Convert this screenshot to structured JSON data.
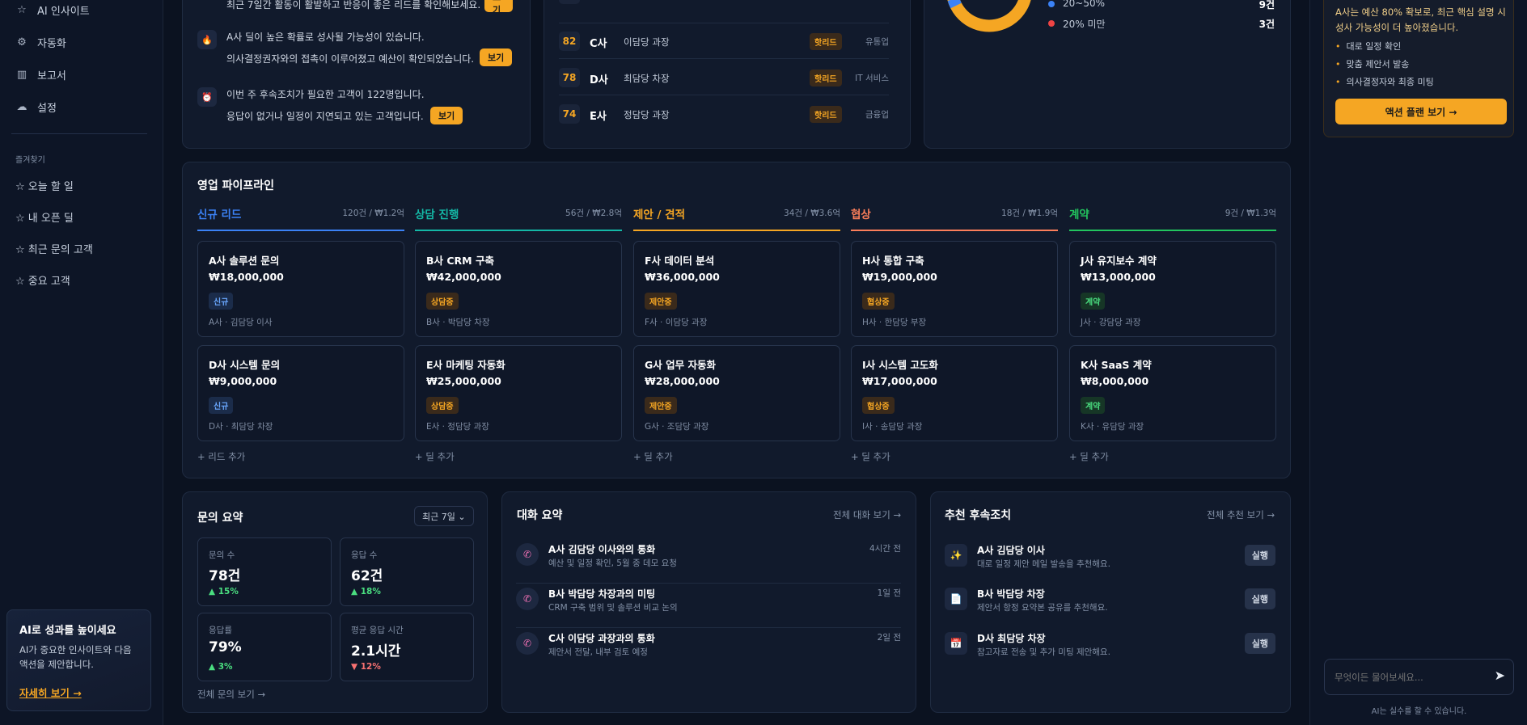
{
  "sidebar": {
    "nav": [
      {
        "label": "AI 인사이트",
        "icon": "star-icon"
      },
      {
        "label": "자동화",
        "icon": "gear-icon"
      },
      {
        "label": "보고서",
        "icon": "bar-chart-icon"
      },
      {
        "label": "설정",
        "icon": "cloud-settings-icon"
      }
    ],
    "favorites_title": "즐겨찾기",
    "favorites": [
      "☆ 오늘 할 일",
      "☆ 내 오픈 딜",
      "☆ 최근 문의 고객",
      "☆ 중요 고객"
    ],
    "promo": {
      "title": "AI로 성과를 높이세요",
      "desc1": "AI가 중요한 인사이트와 다음",
      "desc2": "액션을 제안합니다.",
      "link": "자세히 보기 →"
    }
  },
  "insights": {
    "row0_text": "최근 7일간 활동이 활발하고 반응이 좋은 리드를 확인해보세요.",
    "row0_btn": "보기",
    "row1_line1": "A사 딜이 높은 확률로 성사될 가능성이 있습니다.",
    "row1_line2": "의사결정권자와의 접촉이 이루어졌고 예산이 확인되었습니다.",
    "row1_btn": "보기",
    "row2_line1": "이번 주 후속조치가 필요한 고객이 122명입니다.",
    "row2_line2": "응답이 없거나 일정이 지연되고 있는 고객입니다.",
    "row2_btn": "보기"
  },
  "leads": [
    {
      "score": "82",
      "company": "C사",
      "person": "이담당 과장",
      "badge": "핫리드",
      "industry": "유통업"
    },
    {
      "score": "78",
      "company": "D사",
      "person": "최담당 차장",
      "badge": "핫리드",
      "industry": "IT 서비스"
    },
    {
      "score": "74",
      "company": "E사",
      "person": "정담당 과장",
      "badge": "핫리드",
      "industry": "금융업"
    }
  ],
  "deal_stats": [
    {
      "label": "20~50%",
      "value": "9건",
      "color": "#3b82f6"
    },
    {
      "label": "20% 미만",
      "value": "3건",
      "color": "#ef4444"
    }
  ],
  "donut_colors": {
    "main": "#f5a623",
    "accent": "#3b82f6"
  },
  "ai_panel": {
    "summary1": "A사는 예산 80% 확보로, 최근 핵심 설명 시",
    "summary2": "성사 가능성이 더 높아졌습니다.",
    "bullets": [
      "대로 일정 확인",
      "맞춤 제안서 발송",
      "의사결정자와 최종 미팅"
    ],
    "action_btn": "액션 플랜 보기 →",
    "input_placeholder": "무엇이든 물어보세요...",
    "disclaimer": "AI는 실수를 할 수 있습니다."
  },
  "pipeline": {
    "title": "영업 파이프라인",
    "columns": [
      {
        "name": "신규 리드",
        "meta": "120건 / ₩1.2억",
        "color": "#3b82f6",
        "add": "+ 리드 추가",
        "deals": [
          {
            "name": "A사 솔루션 문의",
            "value": "₩18,000,000",
            "badge": "신규",
            "person": "A사 · 김담당 이사"
          },
          {
            "name": "D사 시스템 문의",
            "value": "₩9,000,000",
            "badge": "신규",
            "person": "D사 · 최담당 차장"
          }
        ]
      },
      {
        "name": "상담 진행",
        "meta": "56건 / ₩2.8억",
        "color": "#14b8a6",
        "add": "+ 딜 추가",
        "deals": [
          {
            "name": "B사 CRM 구축",
            "value": "₩42,000,000",
            "badge": "상담중",
            "person": "B사 · 박담당 차장"
          },
          {
            "name": "E사 마케팅 자동화",
            "value": "₩25,000,000",
            "badge": "상담중",
            "person": "E사 · 정담당 과장"
          }
        ]
      },
      {
        "name": "제안 / 견적",
        "meta": "34건 / ₩3.6억",
        "color": "#f5a623",
        "add": "+ 딜 추가",
        "deals": [
          {
            "name": "F사 데이터 분석",
            "value": "₩36,000,000",
            "badge": "제안중",
            "person": "F사 · 이담당 과장"
          },
          {
            "name": "G사 업무 자동화",
            "value": "₩28,000,000",
            "badge": "제안중",
            "person": "G사 · 조담당 과장"
          }
        ]
      },
      {
        "name": "협상",
        "meta": "18건 / ₩1.9억",
        "color": "#fb7e5a",
        "add": "+ 딜 추가",
        "deals": [
          {
            "name": "H사 통합 구축",
            "value": "₩19,000,000",
            "badge": "협상중",
            "person": "H사 · 한담당 부장"
          },
          {
            "name": "I사 시스템 고도화",
            "value": "₩17,000,000",
            "badge": "협상중",
            "person": "I사 · 송담당 과장"
          }
        ]
      },
      {
        "name": "계약",
        "meta": "9건 / ₩1.3억",
        "color": "#22c55e",
        "add": "+ 딜 추가",
        "deals": [
          {
            "name": "J사 유지보수 계약",
            "value": "₩13,000,000",
            "badge": "계약",
            "person": "J사 · 강담당 과장"
          },
          {
            "name": "K사 SaaS 계약",
            "value": "₩8,000,000",
            "badge": "계약",
            "person": "K사 · 유담당 과장"
          }
        ]
      }
    ]
  },
  "inquiry": {
    "title": "문의 요약",
    "range": "최근 7일 ⌄",
    "metrics": [
      {
        "label": "문의 수",
        "value": "78건",
        "change": "▲ 15%",
        "dir": "up"
      },
      {
        "label": "응답 수",
        "value": "62건",
        "change": "▲ 18%",
        "dir": "up"
      },
      {
        "label": "응답률",
        "value": "79%",
        "change": "▲ 3%",
        "dir": "up"
      },
      {
        "label": "평균 응답 시간",
        "value": "2.1시간",
        "change": "▼ 12%",
        "dir": "down"
      }
    ],
    "link": "전체 문의 보기 →"
  },
  "conversations": {
    "title": "대화 요약",
    "link": "전체 대화 보기 →",
    "items": [
      {
        "title": "A사 김담당 이사와의 통화",
        "sub": "예산 및 일정 확인, 5월 중 데모 요청",
        "time": "4시간 전"
      },
      {
        "title": "B사 박담당 차장과의 미팅",
        "sub": "CRM 구축 범위 및 솔루션 비교 논의",
        "time": "1일 전"
      },
      {
        "title": "C사 이담당 과장과의 통화",
        "sub": "제안서 전달, 내부 검토 예정",
        "time": "2일 전"
      }
    ]
  },
  "recommend": {
    "title": "추천 후속조치",
    "link": "전체 추천 보기 →",
    "btn": "실행",
    "items": [
      {
        "title": "A사 김담당 이사",
        "sub": "대로 일정 제안 메일 발송을 추천해요.",
        "icon": "sparkle-icon",
        "glyph": "✨"
      },
      {
        "title": "B사 박담당 차장",
        "sub": "제안서 항정 요약본 공유를 추천해요.",
        "icon": "document-icon",
        "glyph": "📄"
      },
      {
        "title": "D사 최담당 차장",
        "sub": "참고자료 전송 및 추가 미팅 제안해요.",
        "icon": "calendar-icon",
        "glyph": "📅"
      }
    ]
  }
}
